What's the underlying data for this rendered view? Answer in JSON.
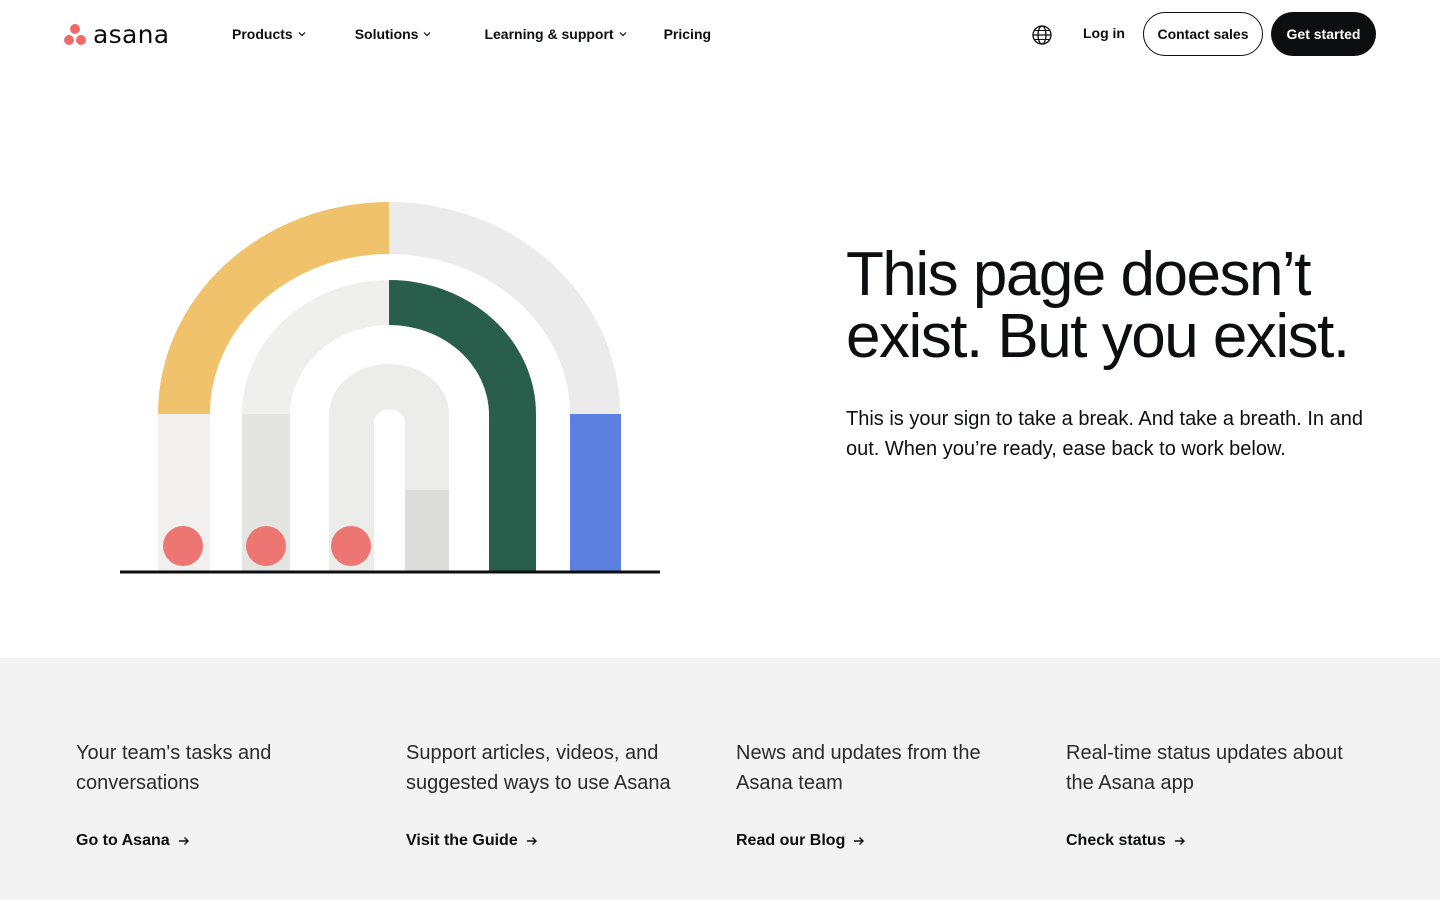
{
  "brand": {
    "name": "asana",
    "accent": "#f06a6a"
  },
  "nav": {
    "products": "Products",
    "solutions": "Solutions",
    "learning": "Learning & support",
    "pricing": "Pricing"
  },
  "header_actions": {
    "globe_icon": "globe-icon",
    "login": "Log in",
    "contact_sales": "Contact sales",
    "get_started": "Get started"
  },
  "hero": {
    "title_line1": "This page doesn’t",
    "title_line2": "exist. But you exist.",
    "subtitle": "This is your sign to take a break. And take a breath. In and out. When you’re ready, ease back to work below."
  },
  "colors": {
    "yellow": "#efc26b",
    "green": "#2a5e4c",
    "blue": "#5b80e0",
    "coral": "#ee7672",
    "light_gray": "#ebebeb",
    "footer_bg": "#f3f3f3"
  },
  "footer_cards": [
    {
      "desc": "Your team's tasks and conversations",
      "link": "Go to Asana"
    },
    {
      "desc": "Support articles, videos, and suggested ways to use Asana",
      "link": "Visit the Guide"
    },
    {
      "desc": "News and updates from the Asana team",
      "link": "Read our Blog"
    },
    {
      "desc": "Real-time status updates about the Asana app",
      "link": "Check status"
    }
  ]
}
